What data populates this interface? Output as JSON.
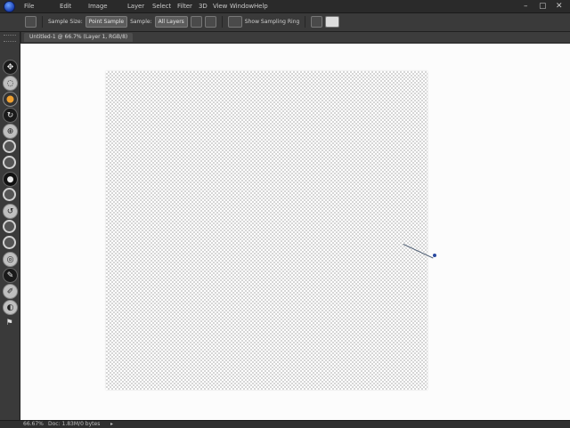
{
  "menubar": {
    "items": [
      "File",
      "Edit",
      "Image",
      "Layer",
      "Select",
      "Filter",
      "3D",
      "View",
      "Window",
      "Help"
    ],
    "window_controls": [
      "–",
      "▢",
      "✕"
    ]
  },
  "options": {
    "sample_size_label": "Sample Size:",
    "sample_size_value": "Point Sample",
    "sample_label": "Sample:",
    "sample_value": "All Layers",
    "show_ring_label": "Show Sampling Ring"
  },
  "document_tab": {
    "title": "Untitled-1 @ 66.7% (Layer 1, RGB/8)"
  },
  "tools": [
    "move-tool",
    "marquee-tool",
    "lasso-tool",
    "quick-select-tool",
    "crop-tool",
    "eyedropper-tool",
    "healing-brush-tool",
    "brush-tool",
    "clone-stamp-tool",
    "history-brush-tool",
    "eraser-tool",
    "gradient-tool",
    "blur-tool",
    "dodge-tool",
    "pen-tool",
    "type-tool",
    "path-selection-tool"
  ],
  "statusbar": {
    "zoom": "66.67%",
    "doc_info": "Doc: 1.83M/0 bytes"
  }
}
